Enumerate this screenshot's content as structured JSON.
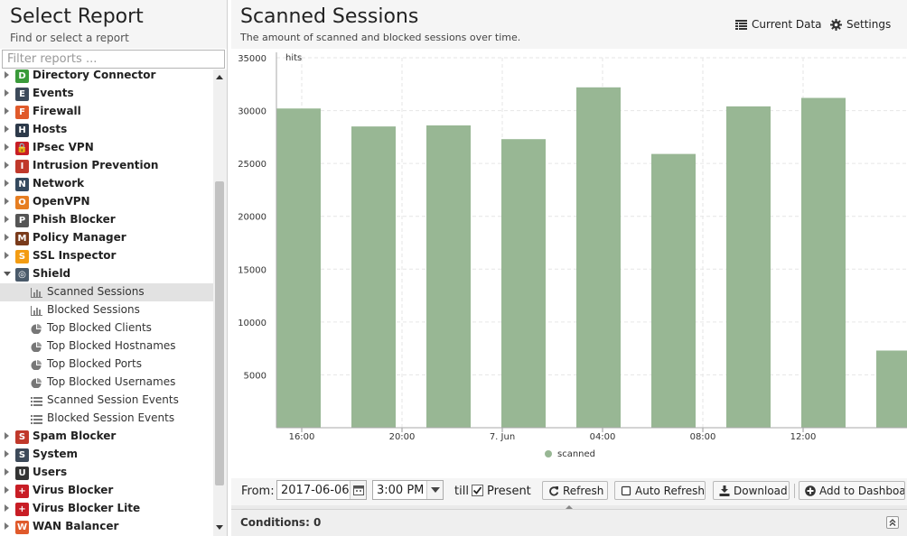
{
  "left_panel": {
    "title": "Select Report",
    "subtitle": "Find or select a report",
    "filter_placeholder": "Filter reports ...",
    "categories": [
      {
        "label": "Directory Connector",
        "icon": "directory-connector-icon",
        "color": "#3a9a3a"
      },
      {
        "label": "Events",
        "icon": "events-icon",
        "color": "#3d4a5a"
      },
      {
        "label": "Firewall",
        "icon": "firewall-icon",
        "color": "#e05a2b"
      },
      {
        "label": "Hosts",
        "icon": "hosts-icon",
        "color": "#2d3a4a"
      },
      {
        "label": "IPsec VPN",
        "icon": "lock-icon",
        "color": "#c81d25"
      },
      {
        "label": "Intrusion Prevention",
        "icon": "intrusion-prevention-icon",
        "color": "#c0392b"
      },
      {
        "label": "Network",
        "icon": "network-icon",
        "color": "#34495e"
      },
      {
        "label": "OpenVPN",
        "icon": "openvpn-icon",
        "color": "#e67e22"
      },
      {
        "label": "Phish Blocker",
        "icon": "phish-blocker-icon",
        "color": "#555555"
      },
      {
        "label": "Policy Manager",
        "icon": "policy-manager-icon",
        "color": "#7a3b1b"
      },
      {
        "label": "SSL Inspector",
        "icon": "ssl-inspector-icon",
        "color": "#f39c12"
      },
      {
        "label": "Shield",
        "icon": "shield-icon",
        "color": "#4a5a6a",
        "expanded": true,
        "children": [
          {
            "label": "Scanned Sessions",
            "icon": "bar-chart-icon",
            "selected": true
          },
          {
            "label": "Blocked Sessions",
            "icon": "bar-chart-icon"
          },
          {
            "label": "Top Blocked Clients",
            "icon": "pie-chart-icon"
          },
          {
            "label": "Top Blocked Hostnames",
            "icon": "pie-chart-icon"
          },
          {
            "label": "Top Blocked Ports",
            "icon": "pie-chart-icon"
          },
          {
            "label": "Top Blocked Usernames",
            "icon": "pie-chart-icon"
          },
          {
            "label": "Scanned Session Events",
            "icon": "list-icon"
          },
          {
            "label": "Blocked Session Events",
            "icon": "list-icon"
          }
        ]
      },
      {
        "label": "Spam Blocker",
        "icon": "spam-blocker-icon",
        "color": "#c0392b"
      },
      {
        "label": "System",
        "icon": "system-icon",
        "color": "#3d4a5a"
      },
      {
        "label": "Users",
        "icon": "users-icon",
        "color": "#333333"
      },
      {
        "label": "Virus Blocker",
        "icon": "virus-blocker-icon",
        "color": "#c81d25"
      },
      {
        "label": "Virus Blocker Lite",
        "icon": "virus-blocker-lite-icon",
        "color": "#c81d25"
      },
      {
        "label": "WAN Balancer",
        "icon": "wan-balancer-icon",
        "color": "#e05a2b"
      }
    ]
  },
  "header": {
    "title": "Scanned Sessions",
    "subtitle": "The amount of scanned and blocked sessions over time.",
    "current_data_label": "Current Data",
    "settings_label": "Settings"
  },
  "chart_data": {
    "type": "bar",
    "ylabel": "hits",
    "ylim": [
      0,
      35000
    ],
    "yticks": [
      5000,
      10000,
      15000,
      20000,
      25000,
      30000,
      35000
    ],
    "xtick_labels": [
      "16:00",
      "20:00",
      "7. Jun",
      "04:00",
      "08:00",
      "12:00"
    ],
    "series": [
      {
        "name": "scanned",
        "color": "#98b794",
        "values": [
          30200,
          28500,
          28600,
          27300,
          32200,
          25900,
          30400,
          31200,
          7300
        ]
      }
    ],
    "grid": true,
    "legend": "bottom"
  },
  "toolbar": {
    "from_label": "From:",
    "date_value": "2017-06-06",
    "time_value": "3:00 PM",
    "till_label": "till",
    "present_label": "Present",
    "present_checked": true,
    "refresh_label": "Refresh",
    "auto_refresh_label": "Auto Refresh",
    "download_label": "Download",
    "add_dashboard_label": "Add to Dashboard"
  },
  "conditions": {
    "label": "Conditions: 0"
  }
}
